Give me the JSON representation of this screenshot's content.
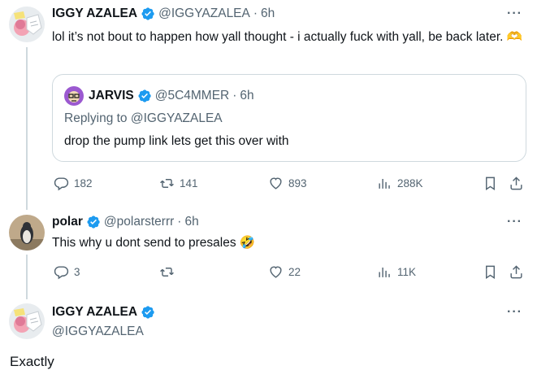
{
  "tweets": [
    {
      "name": "IGGY AZALEA",
      "handle": "@IGGYAZALEA",
      "separator": "·",
      "time": "6h",
      "text": "lol it’s not bout to happen how yall thought - i actually fuck with yall, be back later.",
      "emoji": "🫶",
      "quote": {
        "name": "JARVIS",
        "handle": "@5C4MMER",
        "separator": "·",
        "time": "6h",
        "replying_prefix": "Replying to",
        "replying_handle": "@IGGYAZALEA",
        "text": "drop the pump link lets get this over with"
      },
      "stats": {
        "replies": "182",
        "retweets": "141",
        "likes": "893",
        "views": "288K"
      }
    },
    {
      "name": "polar",
      "handle": "@polarsterrr",
      "separator": "·",
      "time": "6h",
      "text": "This why u dont send to presales",
      "emoji": "🤣",
      "stats": {
        "replies": "3",
        "retweets": "",
        "likes": "22",
        "views": "11K"
      }
    },
    {
      "name": "IGGY AZALEA",
      "handle": "@IGGYAZALEA",
      "text": "Exactly"
    }
  ],
  "more_label": "···",
  "icons": {
    "reply": "reply-icon",
    "retweet": "retweet-icon",
    "like": "heart-icon",
    "views": "views-icon",
    "bookmark": "bookmark-icon",
    "share": "share-icon",
    "verified": "verified-badge-icon"
  },
  "colors": {
    "verified": "#1d9bf0",
    "text": "#0f1419",
    "secondary": "#536471",
    "border": "#cfd9de"
  }
}
